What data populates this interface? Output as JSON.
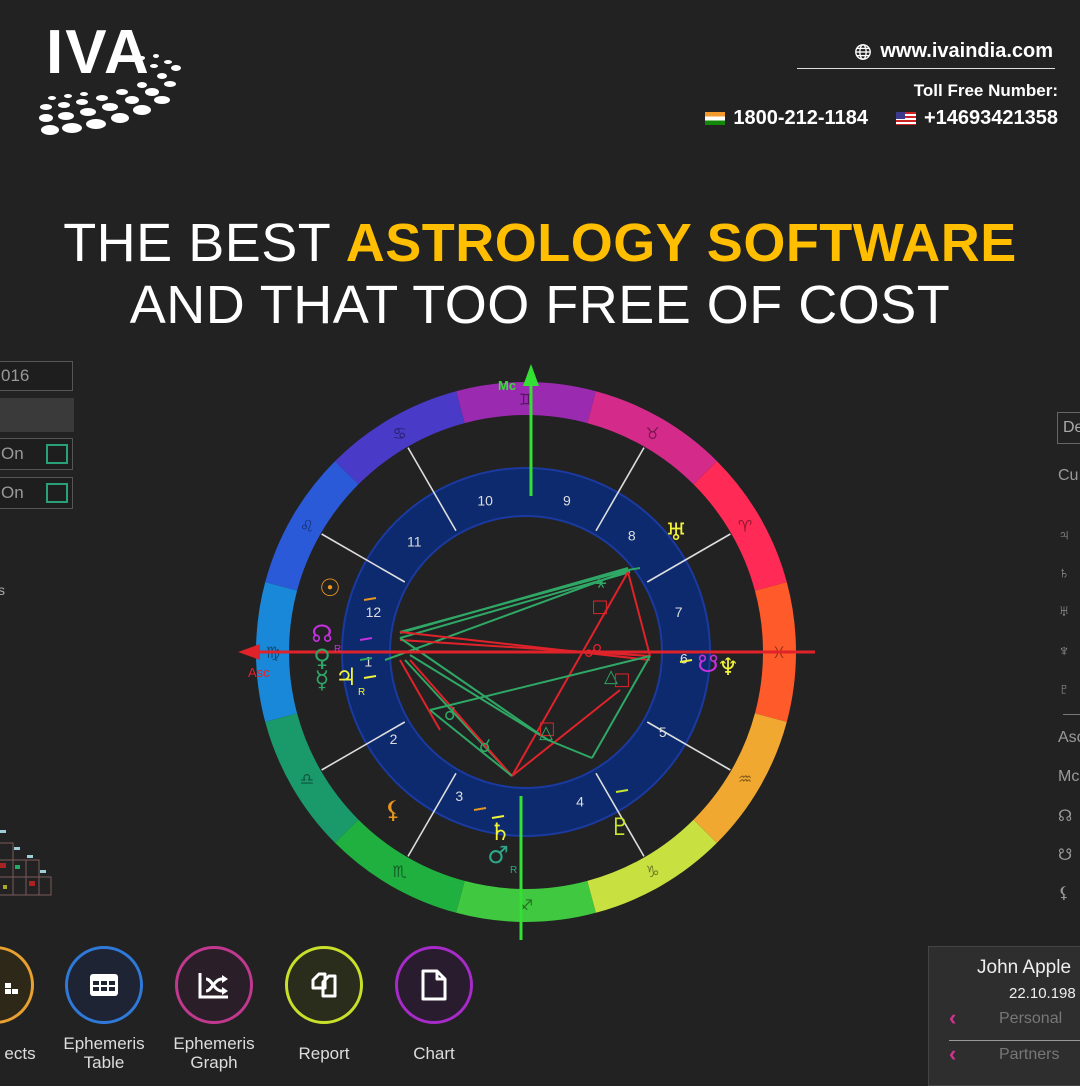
{
  "brand": {
    "logo_text": "IVA"
  },
  "contact": {
    "website": "www.ivaindia.com",
    "toll_free_label": "Toll Free Number:",
    "phone_india": "1800-212-1184",
    "phone_us": "+14693421358"
  },
  "headline": {
    "line1_white": "THE BEST ",
    "line1_yellow": "ASTROLOGY SOFTWARE",
    "line2": "AND THAT TOO FREE OF COST",
    "accent_color": "#ffbf00"
  },
  "left_panel": {
    "date_value": "016",
    "toggle1_label": "On",
    "toggle2_label": "On",
    "side_char": "s"
  },
  "right_panel": {
    "dropdown_text": "De",
    "header": "Cu",
    "items": [
      "♃",
      "♄",
      "♅",
      "♆",
      "♇"
    ],
    "points": [
      "Asc",
      "Mc",
      "☊",
      "☋",
      "⚸"
    ]
  },
  "profile_card": {
    "name": "John Apple",
    "date": "22.10.198",
    "rows": [
      {
        "label": "Personal"
      },
      {
        "label": "Partners"
      }
    ],
    "chevron": "‹"
  },
  "bottom_buttons": [
    {
      "label": "ects",
      "color": "#e8a030"
    },
    {
      "label": "Ephemeris\nTable",
      "color": "#2f79d8"
    },
    {
      "label": "Ephemeris\nGraph",
      "color": "#c0398f"
    },
    {
      "label": "Report",
      "color": "#c9e02a"
    },
    {
      "label": "Chart",
      "color": "#a62bc8"
    }
  ],
  "chart": {
    "axis_labels": {
      "mc": "Mc",
      "asc": "Asc"
    },
    "house_numbers": [
      "1",
      "2",
      "3",
      "4",
      "5",
      "6",
      "7",
      "8",
      "9",
      "10",
      "11",
      "12"
    ],
    "zodiac_signs": [
      "♓",
      "♈",
      "♉",
      "♊",
      "♋",
      "♌",
      "♍",
      "♎",
      "♏",
      "♐",
      "♑",
      "♒"
    ],
    "planets": [
      {
        "glyph": "☉",
        "color": "#e8961e",
        "retro": ""
      },
      {
        "glyph": "☊",
        "color": "#c530e0",
        "retro": "R"
      },
      {
        "glyph": "♀",
        "color": "#2ea665",
        "retro": ""
      },
      {
        "glyph": "☿",
        "color": "#2ea665",
        "retro": ""
      },
      {
        "glyph": "♃",
        "color": "#f3f33a",
        "retro": "R"
      },
      {
        "glyph": "♅",
        "color": "#f3f33a",
        "retro": ""
      },
      {
        "glyph": "☋",
        "color": "#c530e0",
        "retro": ""
      },
      {
        "glyph": "♆",
        "color": "#f3f33a",
        "retro": ""
      },
      {
        "glyph": "♇",
        "color": "#c7e630",
        "retro": ""
      },
      {
        "glyph": "♄",
        "color": "#f3f33a",
        "retro": ""
      },
      {
        "glyph": "♂",
        "color": "#2ea68a",
        "retro": "R"
      },
      {
        "glyph": "⚸",
        "color": "#e8961e",
        "retro": ""
      }
    ]
  }
}
